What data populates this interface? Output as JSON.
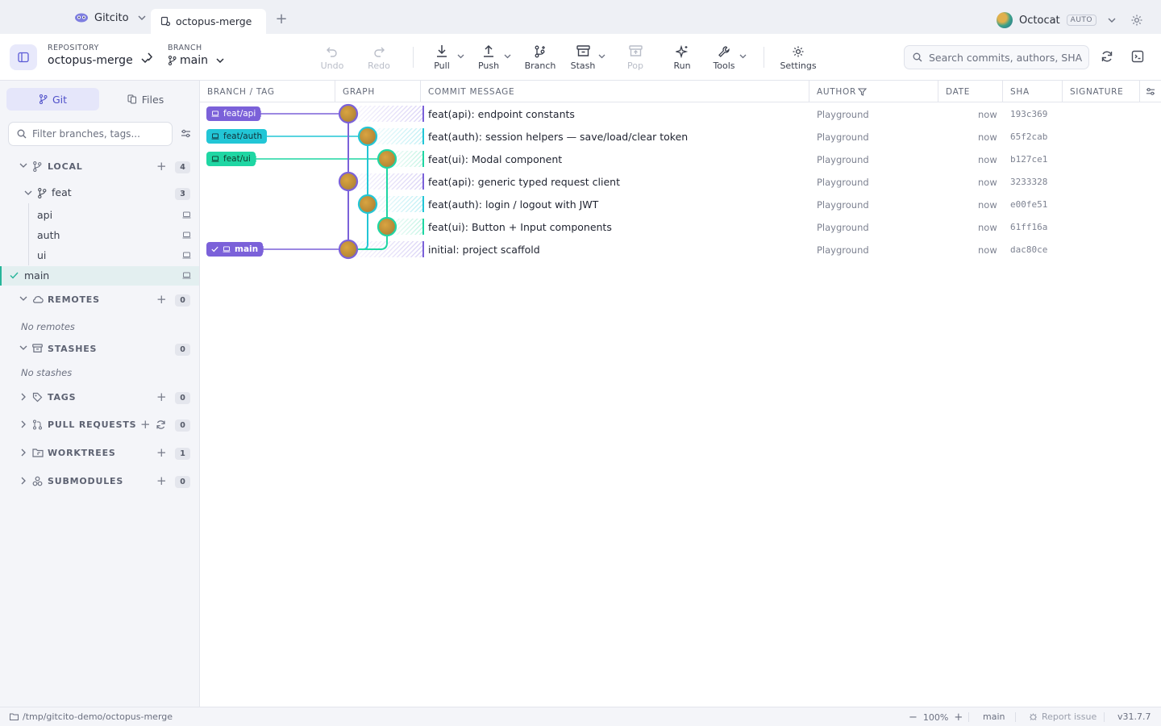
{
  "titlebar": {
    "app_name": "Gitcito",
    "active_tab": "octopus-merge",
    "user_name": "Octocat",
    "theme_badge": "AUTO"
  },
  "toolbar": {
    "repo_label": "REPOSITORY",
    "repo_name": "octopus-merge",
    "branch_label": "BRANCH",
    "branch_name": "main",
    "undo": "Undo",
    "redo": "Redo",
    "pull": "Pull",
    "push": "Push",
    "branch": "Branch",
    "stash": "Stash",
    "pop": "Pop",
    "run": "Run",
    "tools": "Tools",
    "settings": "Settings",
    "search_placeholder": "Search commits, authors, SHAs..."
  },
  "sidebar": {
    "tab_git": "Git",
    "tab_files": "Files",
    "filter_placeholder": "Filter branches, tags...",
    "local": {
      "label": "LOCAL",
      "count": "4"
    },
    "folder": {
      "label": "feat",
      "count": "3"
    },
    "branches": [
      "api",
      "auth",
      "ui"
    ],
    "current_branch": "main",
    "remotes": {
      "label": "REMOTES",
      "count": "0",
      "empty": "No remotes"
    },
    "stashes": {
      "label": "STASHES",
      "count": "0",
      "empty": "No stashes"
    },
    "tags": {
      "label": "TAGS",
      "count": "0"
    },
    "pull_requests": {
      "label": "PULL REQUESTS",
      "count": "0"
    },
    "worktrees": {
      "label": "WORKTREES",
      "count": "1"
    },
    "submodules": {
      "label": "SUBMODULES",
      "count": "0"
    }
  },
  "columns": {
    "branch_tag": "BRANCH / TAG",
    "graph": "GRAPH",
    "message": "COMMIT MESSAGE",
    "author": "AUTHOR",
    "date": "DATE",
    "sha": "SHA",
    "signature": "SIGNATURE"
  },
  "colors": {
    "lane_main": "#7b61d9",
    "lane_auth": "#22c6d6",
    "lane_ui": "#1fd6a3",
    "accent": "#5a5ad6"
  },
  "commits": [
    {
      "ref": "feat/api",
      "message": "feat(api): endpoint constants",
      "author": "Playground",
      "date": "now",
      "sha": "193c369"
    },
    {
      "ref": "feat/auth",
      "message": "feat(auth): session helpers — save/load/clear token",
      "author": "Playground",
      "date": "now",
      "sha": "65f2cab"
    },
    {
      "ref": "feat/ui",
      "message": "feat(ui): Modal component",
      "author": "Playground",
      "date": "now",
      "sha": "b127ce1"
    },
    {
      "ref": "",
      "message": "feat(api): generic typed request client",
      "author": "Playground",
      "date": "now",
      "sha": "3233328"
    },
    {
      "ref": "",
      "message": "feat(auth): login / logout with JWT",
      "author": "Playground",
      "date": "now",
      "sha": "e00fe51"
    },
    {
      "ref": "",
      "message": "feat(ui): Button + Input components",
      "author": "Playground",
      "date": "now",
      "sha": "61ff16a"
    },
    {
      "ref": "main",
      "message": "initial: project scaffold",
      "author": "Playground",
      "date": "now",
      "sha": "dac80ce"
    }
  ],
  "statusbar": {
    "path": "/tmp/gitcito-demo/octopus-merge",
    "zoom": "100%",
    "branch": "main",
    "report": "Report issue",
    "version": "v31.7.7"
  }
}
